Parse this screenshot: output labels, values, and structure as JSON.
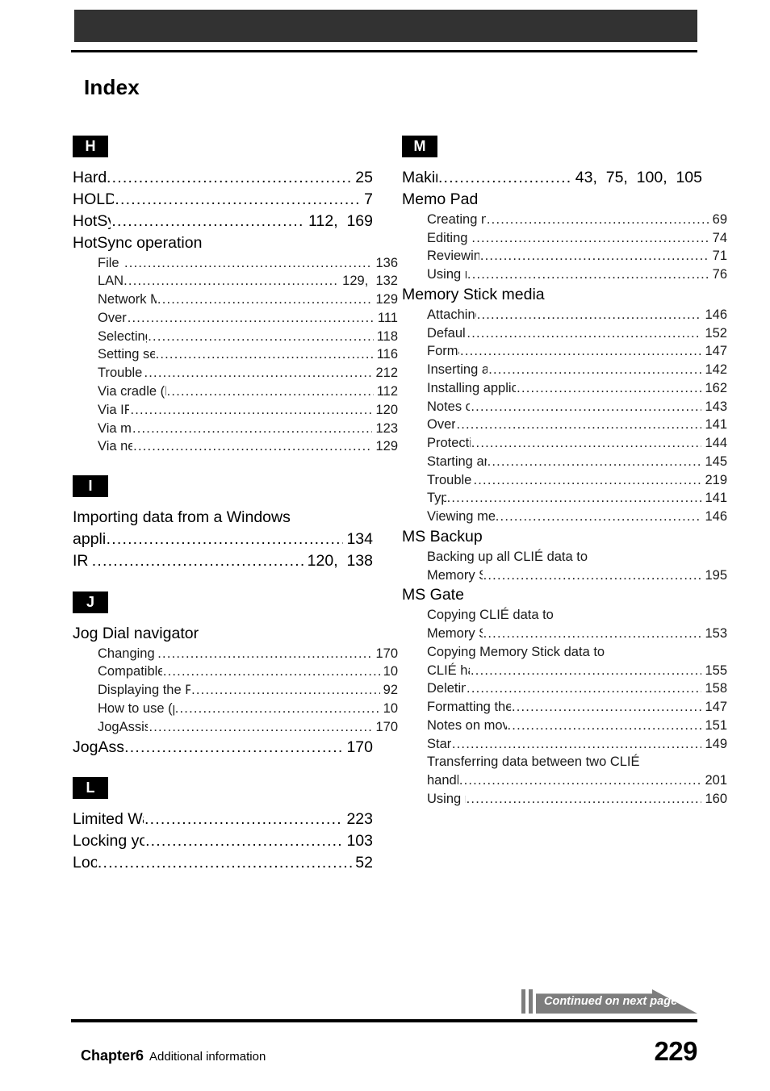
{
  "header": {
    "title": "Index"
  },
  "footer": {
    "chapter": "Chapter6",
    "chapter_sub": "Additional information",
    "page_number": "229"
  },
  "continued_banner": {
    "text": "Continued on next page"
  },
  "columns": [
    {
      "name": "left-column",
      "sections": [
        {
          "letter": "H",
          "entries": [
            {
              "type": "main",
              "label": "Hard reset",
              "page": "25"
            },
            {
              "type": "main",
              "label": "HOLD switch",
              "page": "7"
            },
            {
              "type": "main",
              "label": "HotSync button",
              "page": "112,  169"
            },
            {
              "type": "main",
              "label": "HotSync operation",
              "page": ""
            },
            {
              "type": "sub",
              "label": "File Link",
              "page": "136"
            },
            {
              "type": "sub",
              "label": "LANSync",
              "page": "129,  132"
            },
            {
              "type": "sub",
              "label": "Network Modem Sync",
              "page": "129"
            },
            {
              "type": "sub",
              "label": "Overview",
              "page": "111"
            },
            {
              "type": "sub",
              "label": "Selecting Conduit",
              "page": "118"
            },
            {
              "type": "sub",
              "label": "Setting setup options",
              "page": "116"
            },
            {
              "type": "sub",
              "label": "Troubleshooting",
              "page": "212"
            },
            {
              "type": "sub",
              "label": "Via cradle (Local HotSync)",
              "page": "112"
            },
            {
              "type": "sub",
              "label": "Via IR port",
              "page": "120"
            },
            {
              "type": "sub",
              "label": "Via modem",
              "page": "123"
            },
            {
              "type": "sub",
              "label": "Via network",
              "page": "129"
            }
          ]
        },
        {
          "letter": "I",
          "entries": [
            {
              "type": "main-wrap",
              "label": "Importing data from a Windows",
              "page": ""
            },
            {
              "type": "main",
              "label": "application",
              "page": "134"
            },
            {
              "type": "main",
              "label": "IR port",
              "page": "120,  138"
            }
          ]
        },
        {
          "letter": "J",
          "entries": [
            {
              "type": "main",
              "label": "Jog Dial navigator",
              "page": ""
            },
            {
              "type": "sub",
              "label": "Changing preferences",
              "page": "170"
            },
            {
              "type": "sub",
              "label": "Compatible applications",
              "page": "10"
            },
            {
              "type": "sub",
              "label": "Displaying the Pop-up application menu",
              "page": "92"
            },
            {
              "type": "sub",
              "label": "How to use (pressing/rotating)",
              "page": "10"
            },
            {
              "type": "sub",
              "label": "JogAssist function",
              "page": "170"
            },
            {
              "type": "main",
              "label": "JogAssist function",
              "page": "170"
            }
          ]
        },
        {
          "letter": "L",
          "entries": [
            {
              "type": "main",
              "label": "Limited Warranty Statement",
              "page": "223"
            },
            {
              "type": "main",
              "label": "Locking your CLIÉ handheld",
              "page": "103"
            },
            {
              "type": "main",
              "label": "Lookup",
              "page": "52"
            }
          ]
        }
      ]
    },
    {
      "name": "right-column",
      "sections": [
        {
          "letter": "M",
          "entries": [
            {
              "type": "main",
              "label": "Making items private",
              "page": "43,  75,  100,  105"
            },
            {
              "type": "main",
              "label": "Memo Pad",
              "page": ""
            },
            {
              "type": "sub",
              "label": "Creating new memos",
              "page": "69"
            },
            {
              "type": "sub",
              "label": "Editing memos",
              "page": "74"
            },
            {
              "type": "sub",
              "label": "Reviewing memos",
              "page": "71"
            },
            {
              "type": "sub",
              "label": "Using menus",
              "page": "76"
            },
            {
              "type": "main",
              "label": "Memory Stick media",
              "page": ""
            },
            {
              "type": "sub",
              "label": "Attaching a name",
              "page": "146"
            },
            {
              "type": "sub",
              "label": "Default folder",
              "page": "152"
            },
            {
              "type": "sub",
              "label": "Formatting",
              "page": "147"
            },
            {
              "type": "sub",
              "label": "Inserting and removing",
              "page": "142"
            },
            {
              "type": "sub",
              "label": "Installing applications without MS Gate",
              "page": "162"
            },
            {
              "type": "sub",
              "label": "Notes on using",
              "page": "143"
            },
            {
              "type": "sub",
              "label": "Overview",
              "page": "141"
            },
            {
              "type": "sub",
              "label": "Protecting data",
              "page": "144"
            },
            {
              "type": "sub",
              "label": "Starting an application",
              "page": "145"
            },
            {
              "type": "sub",
              "label": "Troubleshooting",
              "page": "219"
            },
            {
              "type": "sub",
              "label": "Types",
              "page": "141"
            },
            {
              "type": "sub",
              "label": "Viewing media information",
              "page": "146"
            },
            {
              "type": "main",
              "label": "MS Backup",
              "page": ""
            },
            {
              "type": "sub-wrap",
              "label": "Backing up all CLIÉ data to",
              "page": ""
            },
            {
              "type": "sub",
              "label": "Memory Stick media",
              "page": "195"
            },
            {
              "type": "main",
              "label": "MS Gate",
              "page": ""
            },
            {
              "type": "sub-wrap",
              "label": "Copying CLIÉ data to",
              "page": ""
            },
            {
              "type": "sub",
              "label": "Memory Stick media",
              "page": "153"
            },
            {
              "type": "sub-wrap",
              "label": "Copying Memory Stick data to",
              "page": ""
            },
            {
              "type": "sub",
              "label": "CLIÉ handheld",
              "page": "155"
            },
            {
              "type": "sub",
              "label": "Deleting data",
              "page": "158"
            },
            {
              "type": "sub",
              "label": "Formatting the Memory Stick media",
              "page": "147"
            },
            {
              "type": "sub",
              "label": "Notes on moving or copying data",
              "page": "151"
            },
            {
              "type": "sub",
              "label": "Starting",
              "page": "149"
            },
            {
              "type": "sub-wrap",
              "label": "Transferring data between two CLIÉ",
              "page": ""
            },
            {
              "type": "sub",
              "label": "handhelds",
              "page": "201"
            },
            {
              "type": "sub",
              "label": "Using menus",
              "page": "160"
            }
          ]
        }
      ]
    }
  ]
}
